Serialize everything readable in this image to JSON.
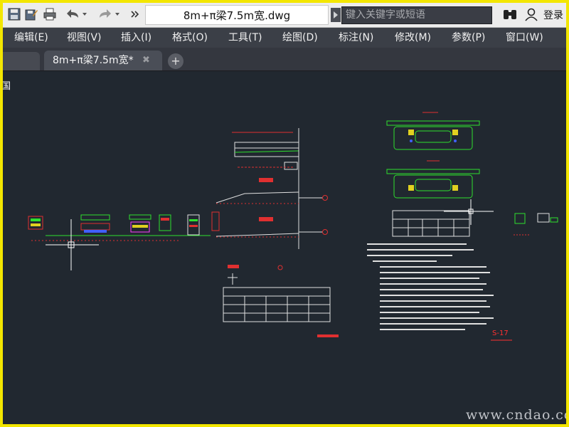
{
  "window": {
    "title": "8m+π梁7.5m宽.dwg",
    "search_placeholder": "键入关键字或短语",
    "login_label": "登录"
  },
  "toolbar_icons": [
    "save-icon",
    "save-as-icon",
    "print-icon",
    "undo-icon",
    "redo-icon",
    "more-icon"
  ],
  "menu": {
    "items": [
      "编辑(E)",
      "视图(V)",
      "插入(I)",
      "格式(O)",
      "工具(T)",
      "绘图(D)",
      "标注(N)",
      "修改(M)",
      "参数(P)",
      "窗口(W)"
    ]
  },
  "tabs": {
    "active_label": "8m+π梁7.5m宽*",
    "close_glyph": "✖",
    "add_glyph": "+"
  },
  "canvas": {
    "viewport_label": "国",
    "drawing_number": "S-17",
    "watermark": "www.cndao.com"
  },
  "colors": {
    "frame_border": "#f3e600",
    "canvas_bg": "#212830",
    "menu_bg": "#3b3f47"
  }
}
